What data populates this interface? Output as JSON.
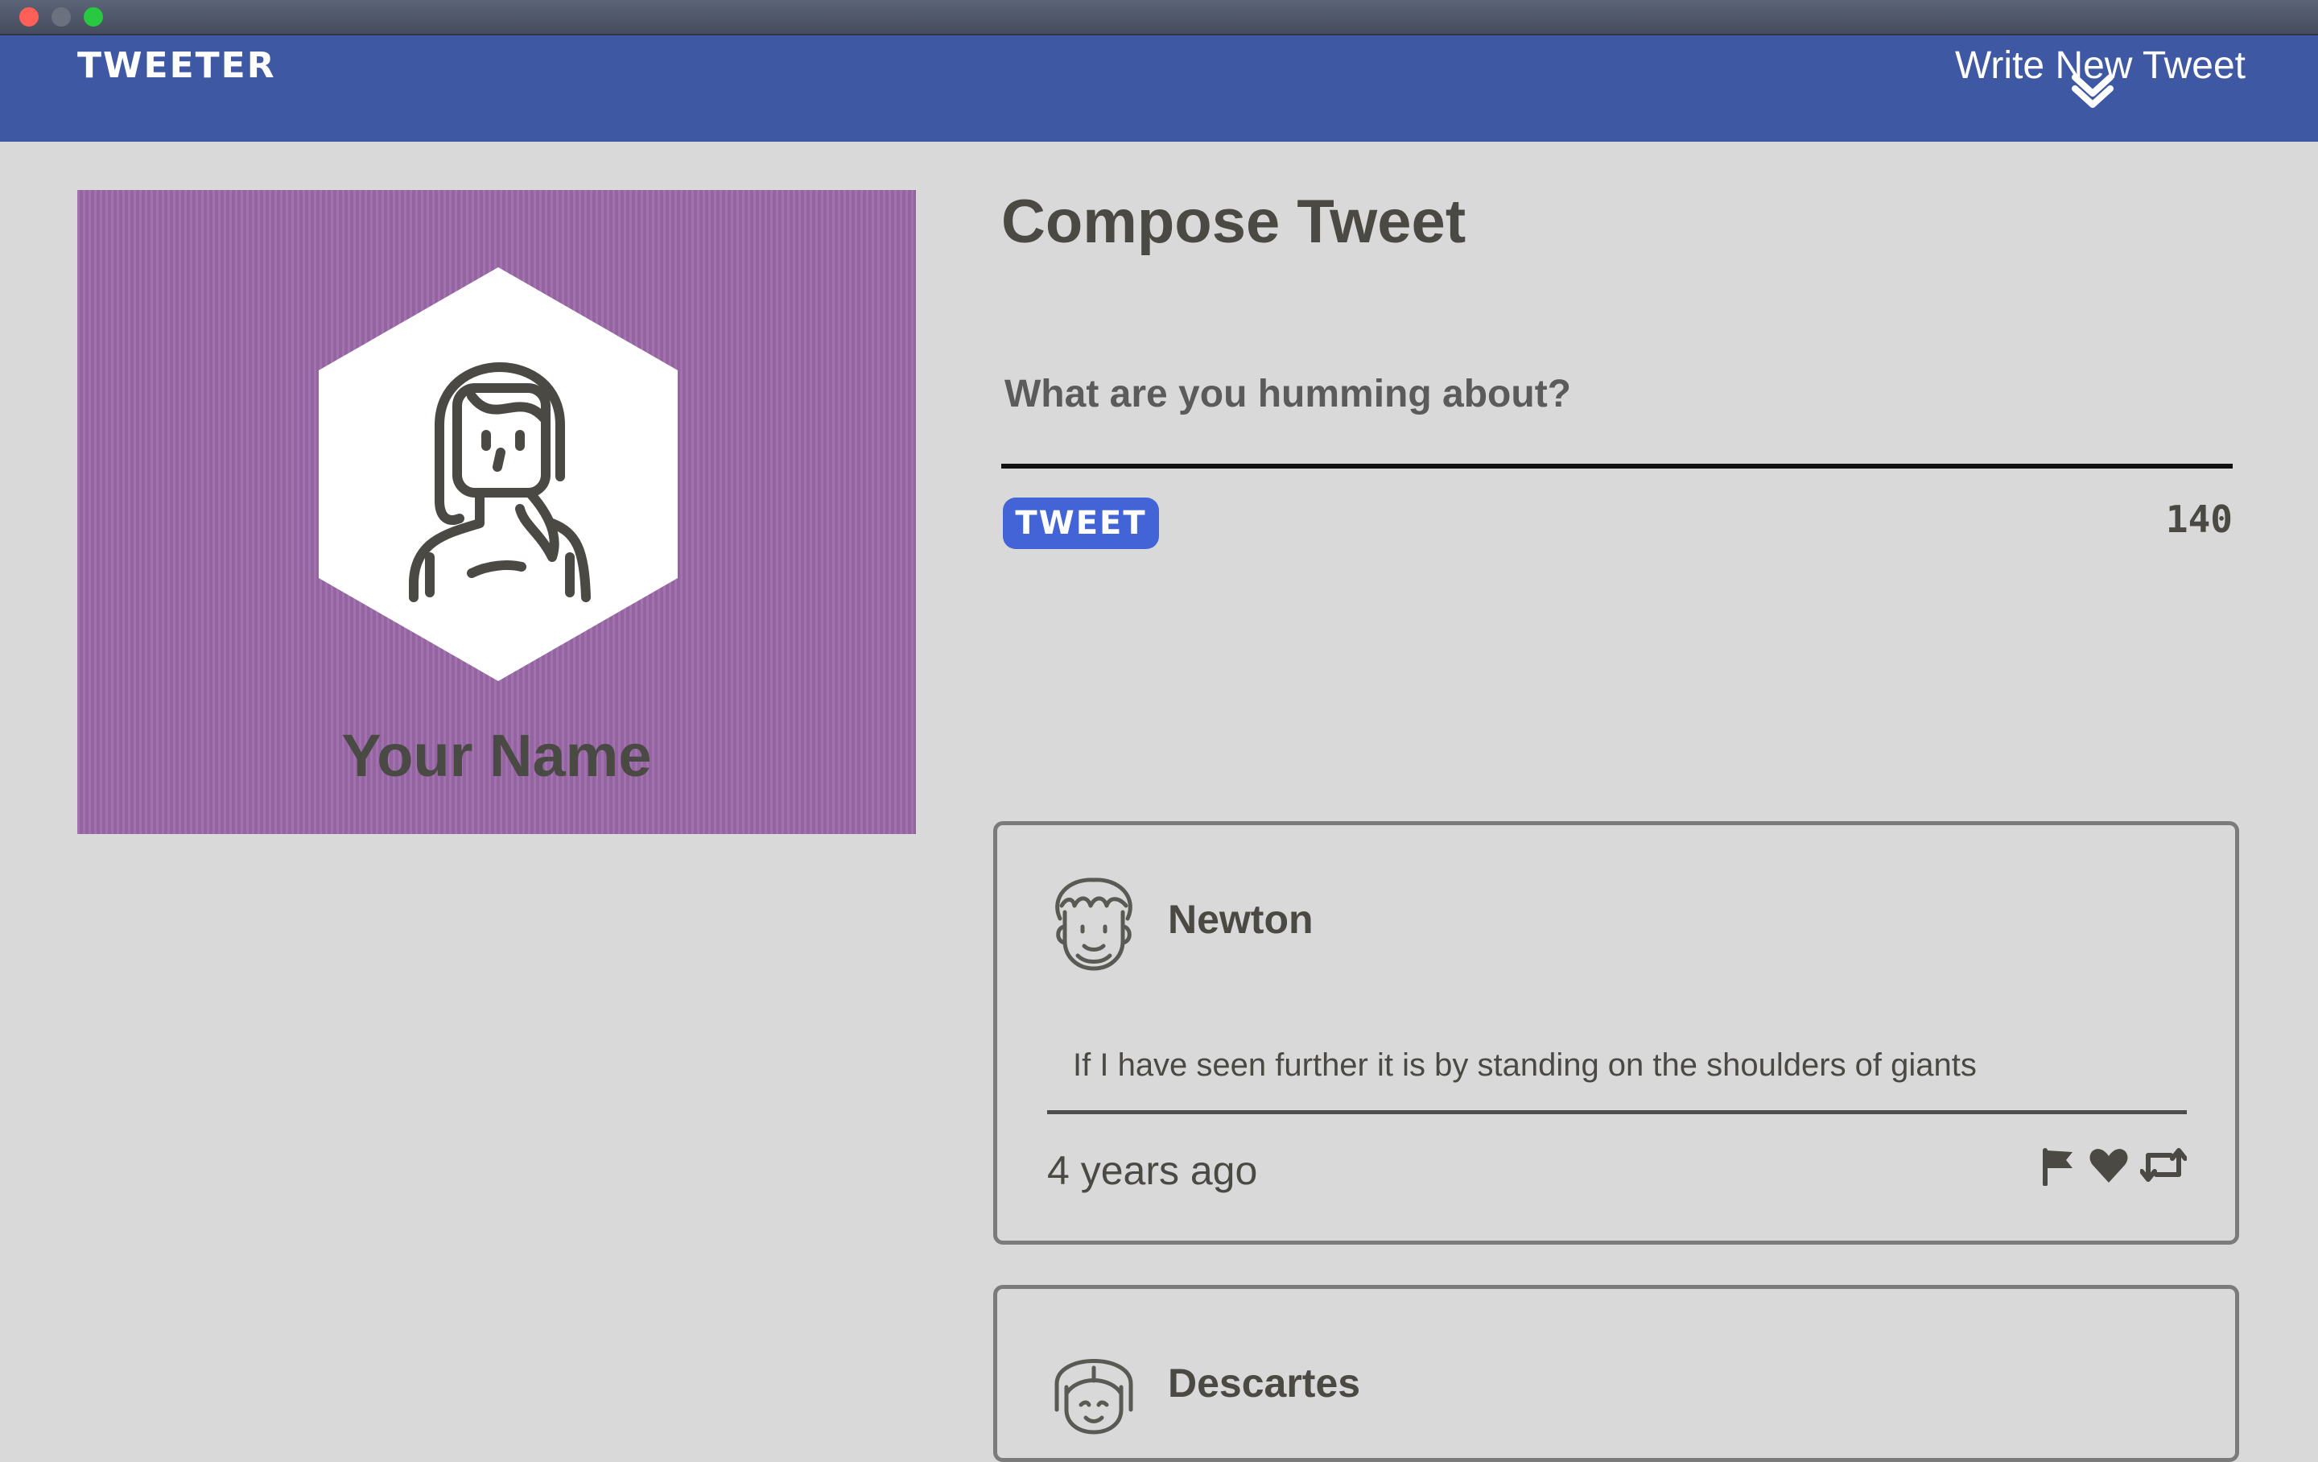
{
  "window": {
    "traffic_lights": [
      "close",
      "minimize",
      "maximize"
    ]
  },
  "nav": {
    "brand": "TWEETER",
    "compose_label": "Write New Tweet",
    "compose_icon": "chevron-down-icon"
  },
  "profile": {
    "name": "Your Name",
    "avatar_icon": "woman-avatar-icon",
    "background_color": "#9c69a9"
  },
  "compose": {
    "title": "Compose Tweet",
    "placeholder": "What are you humming about?",
    "button_label": "TWEET",
    "char_count": "140"
  },
  "tweets": [
    {
      "author": "Newton",
      "avatar_icon": "curly-hair-avatar-icon",
      "text": "If I have seen further it is by standing on the shoulders of giants",
      "time": "4 years ago",
      "actions": [
        "flag-icon",
        "heart-icon",
        "retweet-icon"
      ]
    },
    {
      "author": "Descartes",
      "avatar_icon": "bob-hair-avatar-icon"
    }
  ],
  "colors": {
    "nav_bg": "#3f58a3",
    "page_bg": "#d9d9d9",
    "tweet_button": "#4264d6",
    "text": "#4a4944"
  }
}
